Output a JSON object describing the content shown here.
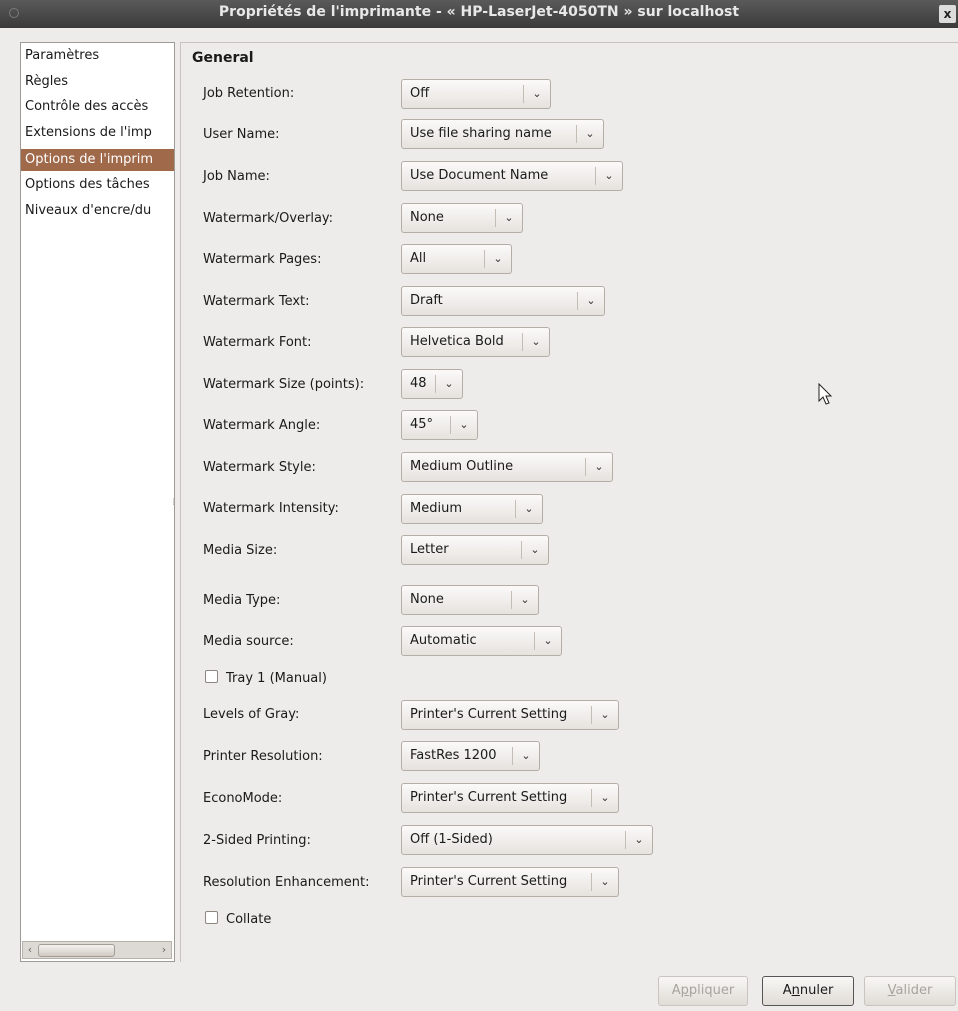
{
  "window": {
    "title": "Propriétés de l'imprimante - « HP-LaserJet-4050TN » sur localhost",
    "close_glyph": "x"
  },
  "sidebar": {
    "items": [
      {
        "label": "Paramètres"
      },
      {
        "label": "Règles"
      },
      {
        "label": "Contrôle des accès"
      },
      {
        "label": "Extensions de l'imp"
      },
      {
        "label": "Options de l'imprim",
        "selected": true
      },
      {
        "label": "Options des tâches"
      },
      {
        "label": "Niveaux d'encre/du"
      }
    ],
    "scroll_left": "‹",
    "scroll_right": "›",
    "selected_color": "#a0694a"
  },
  "section": {
    "title": "General"
  },
  "options": [
    {
      "label": "Job Retention:",
      "value": "Off"
    },
    {
      "label": "User Name:",
      "value": "Use file sharing name"
    },
    {
      "label": "Job Name:",
      "value": "Use Document Name"
    },
    {
      "label": "Watermark/Overlay:",
      "value": "None"
    },
    {
      "label": "Watermark Pages:",
      "value": "All"
    },
    {
      "label": "Watermark Text:",
      "value": "Draft"
    },
    {
      "label": "Watermark Font:",
      "value": "Helvetica Bold"
    },
    {
      "label": "Watermark Size (points):",
      "value": "48"
    },
    {
      "label": "Watermark Angle:",
      "value": "45°"
    },
    {
      "label": "Watermark Style:",
      "value": "Medium Outline"
    },
    {
      "label": "Watermark Intensity:",
      "value": "Medium"
    },
    {
      "label": "Media Size:",
      "value": "Letter"
    },
    {
      "label": "Media Type:",
      "value": "None"
    },
    {
      "label": "Media source:",
      "value": "Automatic"
    },
    {
      "label": "Levels of Gray:",
      "value": "Printer's Current Setting"
    },
    {
      "label": "Printer Resolution:",
      "value": "FastRes 1200"
    },
    {
      "label": "EconoMode:",
      "value": "Printer's Current Setting"
    },
    {
      "label": "2-Sided Printing:",
      "value": "Off (1-Sided)"
    },
    {
      "label": "Resolution Enhancement:",
      "value": "Printer's Current Setting"
    }
  ],
  "checkboxes": {
    "tray1": {
      "label": "Tray 1 (Manual)",
      "checked": false
    },
    "collate": {
      "label": "Collate",
      "checked": false
    }
  },
  "chevron": "⌄",
  "buttons": {
    "apply": {
      "label_pre": "A",
      "label_mnemonic": "p",
      "label_post": "pliquer",
      "enabled": false
    },
    "cancel": {
      "label_pre": "A",
      "label_mnemonic": "n",
      "label_post": "nuler",
      "enabled": true
    },
    "ok": {
      "label_pre": "",
      "label_mnemonic": "V",
      "label_post": "alider",
      "enabled": false
    }
  }
}
